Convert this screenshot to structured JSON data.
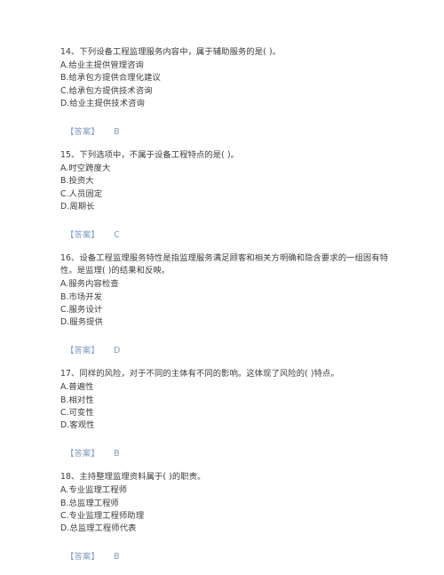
{
  "page": {
    "background_color": "#ffffff",
    "text_color": "#3b3b3b",
    "answer_color": "#7d9bc1",
    "edge_rule_color": "#c9c9c9"
  },
  "questions": [
    {
      "stem": "14、下列设备工程监理服务内容中，属于辅助服务的是( )。",
      "options": [
        "A.给业主提供管理咨询",
        "B.给承包方提供合理化建议",
        "C.给承包方提供技术咨询",
        "D.给业主提供技术咨询"
      ],
      "answer_label": "【答案】",
      "answer_value": "B"
    },
    {
      "stem": "15、下列选项中，不属于设备工程特点的是( )。",
      "options": [
        "A.时空跨度大",
        "B.投资大",
        "C.人员固定",
        "D.周期长"
      ],
      "answer_label": "【答案】",
      "answer_value": "C"
    },
    {
      "stem": "16、设备工程监理服务特性是指监理服务满足顾客和相关方明确和隐含要求的一组固有特性。是监理( )的结果和反映。",
      "options": [
        "A.服务内容检查",
        "B.市场开发",
        "C.服务设计",
        "D.服务提供"
      ],
      "answer_label": "【答案】",
      "answer_value": "D"
    },
    {
      "stem": "17、同样的风险，对于不同的主体有不同的影响。这体现了风险的( )特点。",
      "options": [
        "A.普遍性",
        "B.相对性",
        "C.可变性",
        "D.客观性"
      ],
      "answer_label": "【答案】",
      "answer_value": "B"
    },
    {
      "stem": "18、主持整理监理资料属于( )的职责。",
      "options": [
        "A.专业监理工程师",
        "B.总监理工程师",
        "C.专业监理工程师助理",
        "D.总监理工程师代表"
      ],
      "answer_label": "【答案】",
      "answer_value": "B"
    }
  ]
}
